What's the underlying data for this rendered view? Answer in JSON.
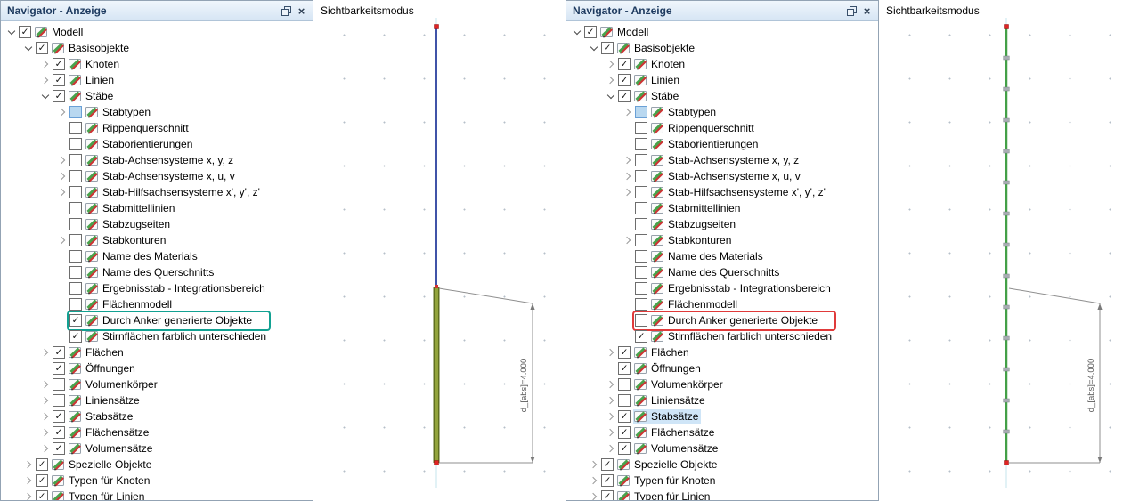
{
  "colors": {
    "left_highlight_box": "#12a192",
    "right_highlight_box": "#e03a3a",
    "selection_background": "#cfe5f7",
    "member_blue": "#4053a8",
    "member_olive": "#7d8f2f",
    "member_green": "#43a047",
    "node_red": "#d42020",
    "titlebar_background": "#d6e5f4"
  },
  "panels": [
    {
      "title": "Navigator - Anzeige",
      "titlebar": {
        "close_glyph": "×"
      },
      "viewport": {
        "label": "Sichtbarkeitsmodus",
        "dimension_label": "d_[abs]=4.000"
      },
      "tree": [
        {
          "label": "Modell",
          "level": 0,
          "arrow": "down",
          "check": "on"
        },
        {
          "label": "Basisobjekte",
          "level": 1,
          "arrow": "down",
          "check": "on"
        },
        {
          "label": "Knoten",
          "level": 2,
          "arrow": "right",
          "check": "on"
        },
        {
          "label": "Linien",
          "level": 2,
          "arrow": "right",
          "check": "on"
        },
        {
          "label": "Stäbe",
          "level": 2,
          "arrow": "down",
          "check": "on"
        },
        {
          "label": "Stabtypen",
          "level": 3,
          "arrow": "right",
          "check": "mixed"
        },
        {
          "label": "Rippenquerschnitt",
          "level": 3,
          "arrow": "none",
          "check": "off"
        },
        {
          "label": "Staborientierungen",
          "level": 3,
          "arrow": "none",
          "check": "off"
        },
        {
          "label": "Stab-Achsensysteme x, y, z",
          "level": 3,
          "arrow": "right",
          "check": "off"
        },
        {
          "label": "Stab-Achsensysteme x, u, v",
          "level": 3,
          "arrow": "right",
          "check": "off"
        },
        {
          "label": "Stab-Hilfsachsensysteme x', y', z'",
          "level": 3,
          "arrow": "right",
          "check": "off"
        },
        {
          "label": "Stabmittellinien",
          "level": 3,
          "arrow": "none",
          "check": "off"
        },
        {
          "label": "Stabzugseiten",
          "level": 3,
          "arrow": "none",
          "check": "off"
        },
        {
          "label": "Stabkonturen",
          "level": 3,
          "arrow": "right",
          "check": "off"
        },
        {
          "label": "Name des Materials",
          "level": 3,
          "arrow": "none",
          "check": "off"
        },
        {
          "label": "Name des Querschnitts",
          "level": 3,
          "arrow": "none",
          "check": "off"
        },
        {
          "label": "Ergebnisstab - Integrationsbereich",
          "level": 3,
          "arrow": "none",
          "check": "off"
        },
        {
          "label": "Flächenmodell",
          "level": 3,
          "arrow": "none",
          "check": "off"
        },
        {
          "label": "Durch Anker generierte Objekte",
          "level": 3,
          "arrow": "none",
          "check": "on",
          "highlight": "teal"
        },
        {
          "label": "Stirnflächen farblich unterschieden",
          "level": 3,
          "arrow": "none",
          "check": "on"
        },
        {
          "label": "Flächen",
          "level": 2,
          "arrow": "right",
          "check": "on"
        },
        {
          "label": "Öffnungen",
          "level": 2,
          "arrow": "none",
          "check": "on"
        },
        {
          "label": "Volumenkörper",
          "level": 2,
          "arrow": "right",
          "check": "off"
        },
        {
          "label": "Liniensätze",
          "level": 2,
          "arrow": "right",
          "check": "off"
        },
        {
          "label": "Stabsätze",
          "level": 2,
          "arrow": "right",
          "check": "on"
        },
        {
          "label": "Flächensätze",
          "level": 2,
          "arrow": "right",
          "check": "on"
        },
        {
          "label": "Volumensätze",
          "level": 2,
          "arrow": "right",
          "check": "on"
        },
        {
          "label": "Spezielle Objekte",
          "level": 1,
          "arrow": "right",
          "check": "on"
        },
        {
          "label": "Typen für Knoten",
          "level": 1,
          "arrow": "right",
          "check": "on"
        },
        {
          "label": "Typen für Linien",
          "level": 1,
          "arrow": "right",
          "check": "on"
        }
      ]
    },
    {
      "title": "Navigator - Anzeige",
      "titlebar": {
        "close_glyph": "×"
      },
      "viewport": {
        "label": "Sichtbarkeitsmodus",
        "dimension_label": "d_[abs]=4.000"
      },
      "tree": [
        {
          "label": "Modell",
          "level": 0,
          "arrow": "down",
          "check": "on"
        },
        {
          "label": "Basisobjekte",
          "level": 1,
          "arrow": "down",
          "check": "on"
        },
        {
          "label": "Knoten",
          "level": 2,
          "arrow": "right",
          "check": "on"
        },
        {
          "label": "Linien",
          "level": 2,
          "arrow": "right",
          "check": "on"
        },
        {
          "label": "Stäbe",
          "level": 2,
          "arrow": "down",
          "check": "on"
        },
        {
          "label": "Stabtypen",
          "level": 3,
          "arrow": "right",
          "check": "mixed"
        },
        {
          "label": "Rippenquerschnitt",
          "level": 3,
          "arrow": "none",
          "check": "off"
        },
        {
          "label": "Staborientierungen",
          "level": 3,
          "arrow": "none",
          "check": "off"
        },
        {
          "label": "Stab-Achsensysteme x, y, z",
          "level": 3,
          "arrow": "right",
          "check": "off"
        },
        {
          "label": "Stab-Achsensysteme x, u, v",
          "level": 3,
          "arrow": "right",
          "check": "off"
        },
        {
          "label": "Stab-Hilfsachsensysteme x', y', z'",
          "level": 3,
          "arrow": "right",
          "check": "off"
        },
        {
          "label": "Stabmittellinien",
          "level": 3,
          "arrow": "none",
          "check": "off"
        },
        {
          "label": "Stabzugseiten",
          "level": 3,
          "arrow": "none",
          "check": "off"
        },
        {
          "label": "Stabkonturen",
          "level": 3,
          "arrow": "right",
          "check": "off"
        },
        {
          "label": "Name des Materials",
          "level": 3,
          "arrow": "none",
          "check": "off"
        },
        {
          "label": "Name des Querschnitts",
          "level": 3,
          "arrow": "none",
          "check": "off"
        },
        {
          "label": "Ergebnisstab - Integrationsbereich",
          "level": 3,
          "arrow": "none",
          "check": "off"
        },
        {
          "label": "Flächenmodell",
          "level": 3,
          "arrow": "none",
          "check": "off"
        },
        {
          "label": "Durch Anker generierte Objekte",
          "level": 3,
          "arrow": "none",
          "check": "off",
          "highlight": "red"
        },
        {
          "label": "Stirnflächen farblich unterschieden",
          "level": 3,
          "arrow": "none",
          "check": "on"
        },
        {
          "label": "Flächen",
          "level": 2,
          "arrow": "right",
          "check": "on"
        },
        {
          "label": "Öffnungen",
          "level": 2,
          "arrow": "none",
          "check": "on"
        },
        {
          "label": "Volumenkörper",
          "level": 2,
          "arrow": "right",
          "check": "off"
        },
        {
          "label": "Liniensätze",
          "level": 2,
          "arrow": "right",
          "check": "off"
        },
        {
          "label": "Stabsätze",
          "level": 2,
          "arrow": "right",
          "check": "on",
          "selected": true
        },
        {
          "label": "Flächensätze",
          "level": 2,
          "arrow": "right",
          "check": "on"
        },
        {
          "label": "Volumensätze",
          "level": 2,
          "arrow": "right",
          "check": "on"
        },
        {
          "label": "Spezielle Objekte",
          "level": 1,
          "arrow": "right",
          "check": "on"
        },
        {
          "label": "Typen für Knoten",
          "level": 1,
          "arrow": "right",
          "check": "on"
        },
        {
          "label": "Typen für Linien",
          "level": 1,
          "arrow": "right",
          "check": "on"
        }
      ]
    }
  ]
}
